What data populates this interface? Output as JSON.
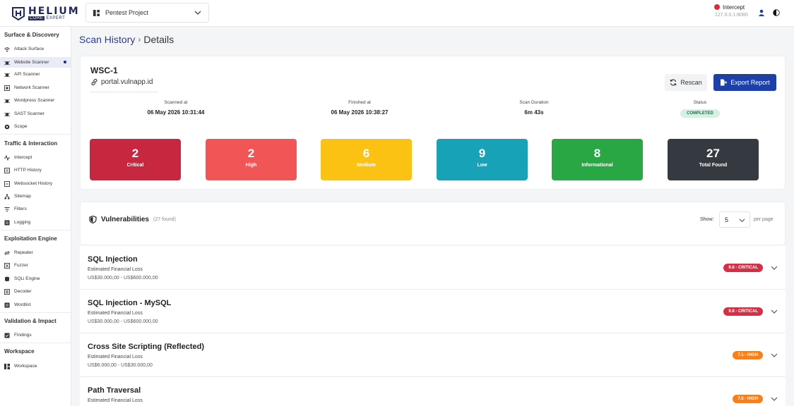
{
  "brand": {
    "name": "HELIUM",
    "tag1": "CORE",
    "tag2": "EXPERT"
  },
  "project": {
    "selected": "Pentest Project"
  },
  "proxy": {
    "label": "Intercept",
    "address": "127.0.0.1:8080",
    "status_color": "#e02a3a"
  },
  "sidebar": {
    "sections": [
      {
        "title": "Surface & Discovery",
        "items": [
          "Attack Surface",
          "Website Scanner",
          "API Scanner",
          "Network Scanner",
          "Wordpress Scanner",
          "SAST Scanner",
          "Scope"
        ]
      },
      {
        "title": "Traffic & Interaction",
        "items": [
          "Intercept",
          "HTTP History",
          "Websocket History",
          "Sitemap",
          "Filters",
          "Logging"
        ]
      },
      {
        "title": "Exploitation Engine",
        "items": [
          "Repeater",
          "Fuzzer",
          "SQLi Engine",
          "Decoder",
          "Wordlist"
        ]
      },
      {
        "title": "Validation & Impact",
        "items": [
          "Findings"
        ]
      },
      {
        "title": "Workspace",
        "items": [
          "Workspace"
        ]
      }
    ],
    "active": "Website Scanner"
  },
  "breadcrumb": {
    "parent": "Scan History",
    "current": "Details"
  },
  "scan": {
    "id": "WSC-1",
    "target": "portal.vulnapp.id",
    "rescan_label": "Rescan",
    "export_label": "Export Report",
    "scanned_at_label": "Scanned at",
    "scanned_at": "06 May 2026 10:31:44",
    "finished_at_label": "Finished at",
    "finished_at": "06 May 2026 10:38:27",
    "duration_label": "Scan Duration",
    "duration": "6m 43s",
    "status_label": "Status",
    "status": "COMPLETED"
  },
  "stats": [
    {
      "count": "2",
      "label": "Critical",
      "color": "#c8283f"
    },
    {
      "count": "2",
      "label": "High",
      "color": "#f25555"
    },
    {
      "count": "6",
      "label": "Medium",
      "color": "#fbc213"
    },
    {
      "count": "9",
      "label": "Low",
      "color": "#17a2b8"
    },
    {
      "count": "8",
      "label": "Informational",
      "color": "#29a745"
    },
    {
      "count": "27",
      "label": "Total Found",
      "color": "#343a40"
    }
  ],
  "vulnerabilities": {
    "title": "Vulnerabilities",
    "count_text": "(27 found)",
    "show_label": "Show:",
    "page_size": "5",
    "per_page_label": "per page",
    "items": [
      {
        "name": "SQL Injection",
        "loss_label": "Estimated Financial Loss",
        "loss": "US$30.000,00 - US$600.000,00",
        "severity": "9.8 - CRITICAL",
        "color": "#d62f45"
      },
      {
        "name": "SQL Injection - MySQL",
        "loss_label": "Estimated Financial Loss",
        "loss": "US$30.000,00 - US$600.000,00",
        "severity": "9.8 - CRITICAL",
        "color": "#d62f45"
      },
      {
        "name": "Cross Site Scripting (Reflected)",
        "loss_label": "Estimated Financial Loss",
        "loss": "US$6.000,00 - US$30.000,00",
        "severity": "7.1 - HIGH",
        "color": "#fd7e14"
      },
      {
        "name": "Path Traversal",
        "loss_label": "Estimated Financial Loss",
        "loss": "",
        "severity": "7.5 - HIGH",
        "color": "#fd7e14"
      }
    ]
  }
}
